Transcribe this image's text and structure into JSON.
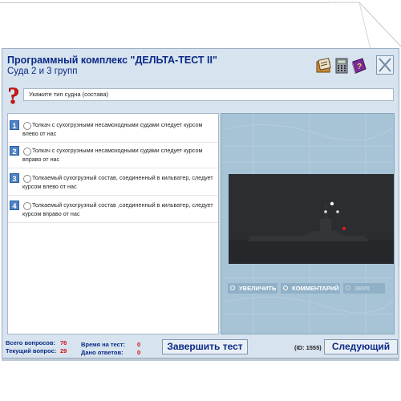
{
  "window": {
    "title": "Программный комплекс \"ДЕЛЬТА-ТЕСТ II\"",
    "subtitle": "Суда 2 и 3 групп"
  },
  "toolbar": {
    "icons": [
      "calculator-book-icon",
      "calculator-icon",
      "help-book-icon",
      "close-icon"
    ]
  },
  "question": {
    "text": "Укажите тип судна (состава)"
  },
  "answers": [
    {
      "num": "1",
      "text": "Толкач с сухогрузными несамоходными судами следует курсом влево от нас"
    },
    {
      "num": "2",
      "text": "Толкач с сухогрузными несамоходными судами следует курсом вправо от нас"
    },
    {
      "num": "3",
      "text": "Толкаемый сухогрузный состав, соединенный в кильватер, следует курсом влево от нас"
    },
    {
      "num": "4",
      "text": "Толкаемый сухогрузный состав ,соединенный в кильватер, следует курсом вправо от нас"
    }
  ],
  "media": {
    "zoom_label": "УВЕЛИЧИТЬ",
    "comment_label": "КОММЕНТАРИЙ",
    "sound_label": "ЗВУК"
  },
  "status": {
    "total_label": "Всего вопросов:",
    "total_value": "76",
    "current_label": "Текущий вопрос:",
    "current_value": "29",
    "time_label": "Время на тест:",
    "time_value": "0",
    "answered_label": "Дано ответов:",
    "answered_value": "0"
  },
  "buttons": {
    "finish_label": "Завершить тест",
    "next_label": "Следующий"
  },
  "id_label": "(ID: 1555)",
  "colors": {
    "window_bg": "#d7e4ef",
    "title_color": "#0b2a86",
    "value_red": "#d01010",
    "number_badge": "#4c82c7"
  }
}
